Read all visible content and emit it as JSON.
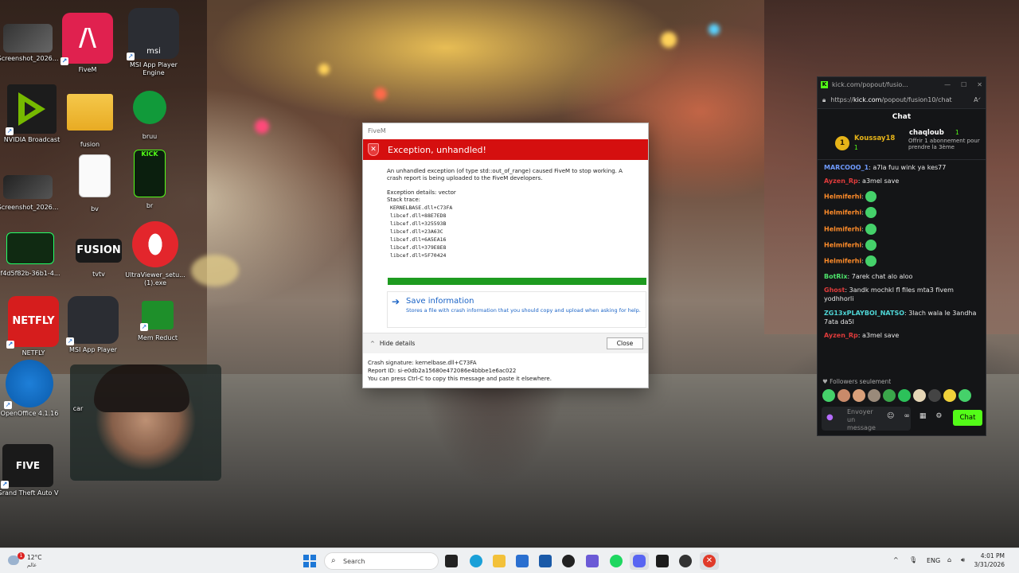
{
  "desktop": {
    "icons": [
      {
        "label": "Screenshot_2026..."
      },
      {
        "label": "FiveM"
      },
      {
        "label": "MSI App Player Engine"
      },
      {
        "label": "NVIDIA Broadcast"
      },
      {
        "label": "fusion"
      },
      {
        "label": "bruu"
      },
      {
        "label": "Screenshot_2026..."
      },
      {
        "label": "bv"
      },
      {
        "label": "br"
      },
      {
        "label": "f4d5f82b-36b1-4..."
      },
      {
        "label": "tvtv"
      },
      {
        "label": "UltraViewer_setu... (1).exe"
      },
      {
        "label": "NETFLY"
      },
      {
        "label": "MSI App Player"
      },
      {
        "label": "Mem Reduct"
      },
      {
        "label": "OpenOffice 4.1.16"
      },
      {
        "label": "car"
      },
      {
        "label": "Grand Theft Auto V"
      }
    ],
    "icon_texts": {
      "netfly": "NETFLY",
      "fusion_tv": "FUSION",
      "kick": "KICK",
      "gta": "FIVE",
      "msi": "msi"
    }
  },
  "dialog": {
    "window_title": "FiveM",
    "heading": "Exception, unhandled!",
    "message": "An unhandled exception (of type std::out_of_range) caused FiveM to stop working. A crash report is being uploaded to the FiveM developers.",
    "details_label": "Exception details: vector",
    "stack_label": "Stack trace:",
    "stack": [
      "KERNELBASE.dll+C73FA",
      "libcef.dll+88E7ED8",
      "libcef.dll+325593B",
      "libcef.dll+23A63C",
      "libcef.dll+6A5EA16",
      "libcef.dll+379E8E8",
      "libcef.dll+5F70424"
    ],
    "progress": 1.0,
    "save_title": "Save information",
    "save_desc": "Stores a file with crash information that you should copy and upload when asking for help.",
    "hide_details": "Hide details",
    "close": "Close",
    "crash_signature": "Crash signature: kernelbase.dll+C73FA",
    "report_id": "Report ID: si-e0db2a15680e472086e4bbbe1e6ac022",
    "copy_hint": "You can press Ctrl-C to copy this message and paste it elsewhere."
  },
  "kick": {
    "tab_title": "kick.com/popout/fusio...",
    "url_prefix": "https://",
    "url_domain": "kick.com",
    "url_path": "/popout/fusion10/chat",
    "chat_header": "Chat",
    "pinned": {
      "rank": "1",
      "user1": "Koussay18",
      "user1_count": "1",
      "user2": "chaqloub",
      "user2_count": "1",
      "user2_sub": "Offrir 1 abonnement pour prendre la 3ème"
    },
    "messages": [
      {
        "user": "MARCOOO_1",
        "color": "#6f9bff",
        "text": ": a7la fuu wink ya kes77"
      },
      {
        "user": "Ayzen_Rp",
        "color": "#e03b3b",
        "text": ": a3mel save"
      },
      {
        "user": "Helmiferhi",
        "color": "#ff8c2a",
        "text": ":"
      },
      {
        "user": "Helmiferhi",
        "color": "#ff8c2a",
        "text": ":"
      },
      {
        "user": "Helmiferhi",
        "color": "#ff8c2a",
        "text": ":"
      },
      {
        "user": "Helmiferhi",
        "color": "#ff8c2a",
        "text": ":"
      },
      {
        "user": "Helmiferhi",
        "color": "#ff8c2a",
        "text": ":"
      },
      {
        "user": "BotRix",
        "color": "#4de36b",
        "text": ": 7arek chat alo aloo"
      },
      {
        "user": "Ghost",
        "color": "#e03b3b",
        "text": ": 3andk mochkl fl files mta3 fivem yodhhorli"
      },
      {
        "user": "ZG13xPLAYBOI_NATSO",
        "color": "#4fd6d6",
        "text": ": 3lach wala le 3andha 7ata da5l"
      },
      {
        "user": "Ayzen_Rp",
        "color": "#e03b3b",
        "text": ": a3mel save"
      }
    ],
    "followers_only": "Followers seulement",
    "input_placeholder": "Envoyer un message",
    "send_label": "Chat"
  },
  "taskbar": {
    "weather_badge": "1",
    "temperature": "12°C",
    "city": "عالم",
    "search_placeholder": "Search",
    "lang": "ENG",
    "time": "4:01 PM",
    "date": "3/31/2026"
  },
  "colors": {
    "dialog_red": "#d50f0f",
    "progress_green": "#1e9b20",
    "kick_green": "#53fc18",
    "link_blue": "#1a63c6"
  }
}
